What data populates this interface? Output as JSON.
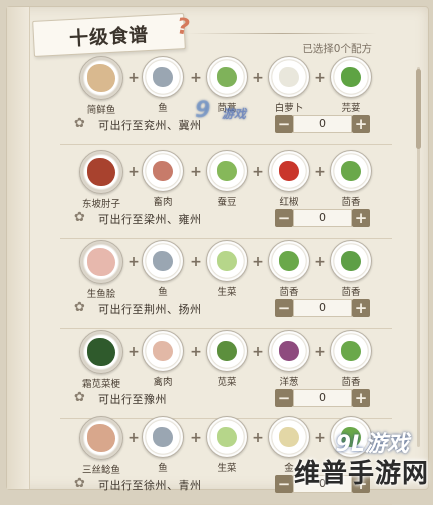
{
  "header": {
    "title": "十级食谱",
    "selected_count": "已选择0个配方"
  },
  "recipes": [
    {
      "dish": {
        "name": "简鲜鱼",
        "color": "#d9b98f"
      },
      "ingredients": [
        {
          "name": "鱼",
          "color": "#9aa6b2"
        },
        {
          "name": "茼蒿",
          "color": "#7fb25a"
        },
        {
          "name": "白萝卜",
          "color": "#e9e7dc"
        },
        {
          "name": "芫荽",
          "color": "#5ea343"
        }
      ],
      "destination": "可出行至兖州、冀州",
      "quantity": "0"
    },
    {
      "dish": {
        "name": "东坡肘子",
        "color": "#a8422e"
      },
      "ingredients": [
        {
          "name": "畜肉",
          "color": "#c77b6a"
        },
        {
          "name": "蚕豆",
          "color": "#86b85a"
        },
        {
          "name": "红椒",
          "color": "#c9362b"
        },
        {
          "name": "茴香",
          "color": "#6aa84a"
        }
      ],
      "destination": "可出行至梁州、雍州",
      "quantity": "0"
    },
    {
      "dish": {
        "name": "生鱼脍",
        "color": "#e7b8ad"
      },
      "ingredients": [
        {
          "name": "鱼",
          "color": "#9aa6b2"
        },
        {
          "name": "生菜",
          "color": "#b6d68a"
        },
        {
          "name": "茴香",
          "color": "#6aa84a"
        },
        {
          "name": "茴香",
          "color": "#5e9f46"
        }
      ],
      "destination": "可出行至荆州、扬州",
      "quantity": "0"
    },
    {
      "dish": {
        "name": "霜苋菜梗",
        "color": "#2f5a2c"
      },
      "ingredients": [
        {
          "name": "禽肉",
          "color": "#e2b8a6"
        },
        {
          "name": "苋菜",
          "color": "#5c8f3d"
        },
        {
          "name": "洋葱",
          "color": "#8e4b7e"
        },
        {
          "name": "茴香",
          "color": "#6aa84a"
        }
      ],
      "destination": "可出行至豫州",
      "quantity": "0"
    },
    {
      "dish": {
        "name": "三丝鲶鱼",
        "color": "#d8a78c"
      },
      "ingredients": [
        {
          "name": "鱼",
          "color": "#9aa6b2"
        },
        {
          "name": "生菜",
          "color": "#b6d68a"
        },
        {
          "name": "金",
          "color": "#e3d7a6"
        },
        {
          "name": "",
          "color": "#6aa84a"
        }
      ],
      "destination": "可出行至徐州、青州",
      "quantity": "0"
    }
  ],
  "icons": {
    "flower": "flower-icon",
    "minus": "minus-icon",
    "plus": "plus-icon"
  },
  "watermarks": {
    "center_logo": "9",
    "center_text": "游戏",
    "corner_logo": "9L游戏",
    "corner_brand": "维普手游网"
  }
}
